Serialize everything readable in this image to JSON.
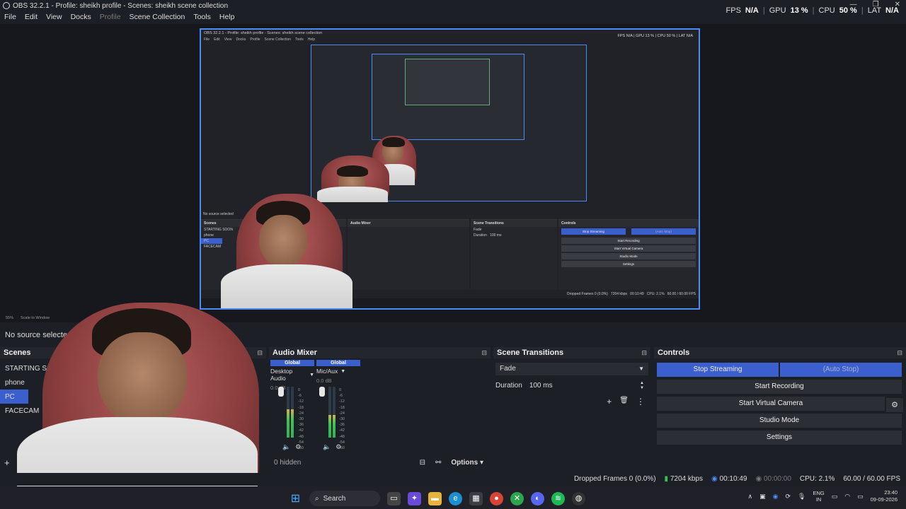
{
  "window": {
    "title": "OBS 32.2.1 - Profile: sheikh profile - Scenes: sheikh scene collection"
  },
  "stats": {
    "fps_label": "FPS",
    "fps": "N/A",
    "gpu_label": "GPU",
    "gpu": "13 %",
    "cpu_label": "CPU",
    "cpu": "50 %",
    "lat_label": "LAT",
    "lat": "N/A"
  },
  "menu": {
    "file": "File",
    "edit": "Edit",
    "view": "View",
    "docks": "Docks",
    "profile": "Profile",
    "scene_collection": "Scene Collection",
    "tools": "Tools",
    "help": "Help"
  },
  "zoom": {
    "level": "55%",
    "mode": "Scale to Window"
  },
  "source_bar": {
    "text": "No source selected"
  },
  "scenes": {
    "title": "Scenes",
    "items": [
      {
        "label": "STARTING SOON"
      },
      {
        "label": "phone"
      },
      {
        "label": "PC"
      },
      {
        "label": "FACECAM"
      }
    ],
    "selected": "PC"
  },
  "audio_mixer": {
    "title": "Audio Mixer",
    "channels": [
      {
        "badge": "Global",
        "name": "Desktop Audio",
        "db": "0.0 dB",
        "level": 0.55
      },
      {
        "badge": "Global",
        "name": "Mic/Aux",
        "db": "0.0 dB",
        "level": 0.45
      }
    ],
    "scale": [
      "0",
      "-6",
      "-12",
      "-18",
      "-24",
      "-30",
      "-36",
      "-42",
      "-48",
      "-54",
      "-60"
    ],
    "hidden": "0 hidden",
    "options": "Options"
  },
  "scene_transitions": {
    "title": "Scene Transitions",
    "transition": "Fade",
    "duration_label": "Duration",
    "duration": "100 ms"
  },
  "controls": {
    "title": "Controls",
    "stop_streaming": "Stop Streaming",
    "auto_stop": "(Auto Stop)",
    "start_recording": "Start Recording",
    "start_virtual_camera": "Start Virtual Camera",
    "studio_mode": "Studio Mode",
    "settings": "Settings"
  },
  "statusbar": {
    "dropped_frames": "Dropped Frames 0 (0.0%)",
    "bitrate": "7204 kbps",
    "stream_time": "00:10:49",
    "rec_time": "00:00:00",
    "cpu": "CPU: 2.1%",
    "fps": "60.00 / 60.00 FPS"
  },
  "taskbar": {
    "search": "Search",
    "lang_line1": "ENG",
    "lang_line2": "IN",
    "time": "23:40",
    "date": "09-09-2026"
  },
  "colors": {
    "accent": "#3b5fcc",
    "preview_border": "#4c8cf5",
    "meter_green": "#3cc25a"
  }
}
